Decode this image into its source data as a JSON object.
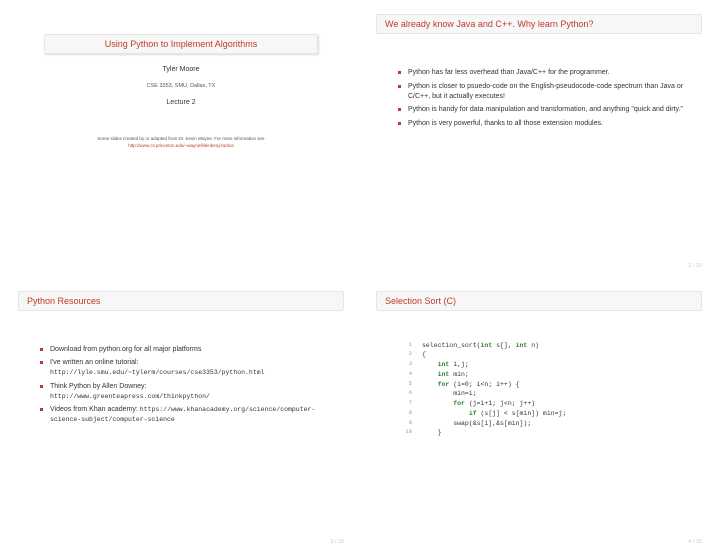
{
  "slide1": {
    "title": "Using Python to Implement Algorithms",
    "author": "Tyler Moore",
    "course": "CSE 3353, SMU, Dallas, TX",
    "lecture": "Lecture 2",
    "credit": "Some slides created by or adapted from Dr. Kevin Wayne. For more information see",
    "credit_url": "http://www.cs.princeton.edu/~wayne/kleinberg-tardos"
  },
  "slide2": {
    "title": "We already know Java and C++. Why learn Python?",
    "bullets": [
      "Python has far less overhead than Java/C++ for the programmer.",
      "Python is closer to psuedo-code on the English-pseudocode-code spectrum than Java or C/C++, but it actually executes!",
      "Python is handy for data manipulation and transformation, and anything \"quick and dirty.\"",
      "Python is very powerful, thanks to all those extension modules."
    ],
    "page": "2 / 33"
  },
  "slide3": {
    "title": "Python Resources",
    "items": [
      {
        "text": "Download from python.org for all major platforms",
        "url": ""
      },
      {
        "text": "I've written an online tutorial:",
        "url": "http://lyle.smu.edu/~tylerm/courses/cse3353/python.html"
      },
      {
        "text": "Think Python by Allen Downey:",
        "url": "http://www.greenteapress.com/thinkpython/"
      },
      {
        "text": "Videos from Khan academy: ",
        "url": "https://www.khanacademy.org/science/computer-science-subject/computer-science"
      }
    ],
    "page": "3 / 33"
  },
  "slide4": {
    "title": "Selection Sort (C)",
    "code": [
      {
        "n": "1",
        "pre": "",
        "kw": "",
        "post": "selection_sort(",
        "kw2": "int",
        "post2": " s[], ",
        "kw3": "int",
        "post3": " n)"
      },
      {
        "n": "2",
        "pre": "{",
        "kw": "",
        "post": ""
      },
      {
        "n": "3",
        "pre": "    ",
        "kw": "int",
        "post": " i,j;"
      },
      {
        "n": "4",
        "pre": "    ",
        "kw": "int",
        "post": " min;"
      },
      {
        "n": "5",
        "pre": "    ",
        "kw": "for",
        "post": " (i=0; i<n; i++) {"
      },
      {
        "n": "6",
        "pre": "        min=i;",
        "kw": "",
        "post": ""
      },
      {
        "n": "7",
        "pre": "        ",
        "kw": "for",
        "post": " (j=i+1; j<n; j++)"
      },
      {
        "n": "8",
        "pre": "            ",
        "kw": "if",
        "post": " (s[j] < s[min]) min=j;"
      },
      {
        "n": "9",
        "pre": "        swap(&s[i],&s[min]);",
        "kw": "",
        "post": ""
      },
      {
        "n": "10",
        "pre": "    }",
        "kw": "",
        "post": ""
      }
    ],
    "page": "4 / 33"
  }
}
